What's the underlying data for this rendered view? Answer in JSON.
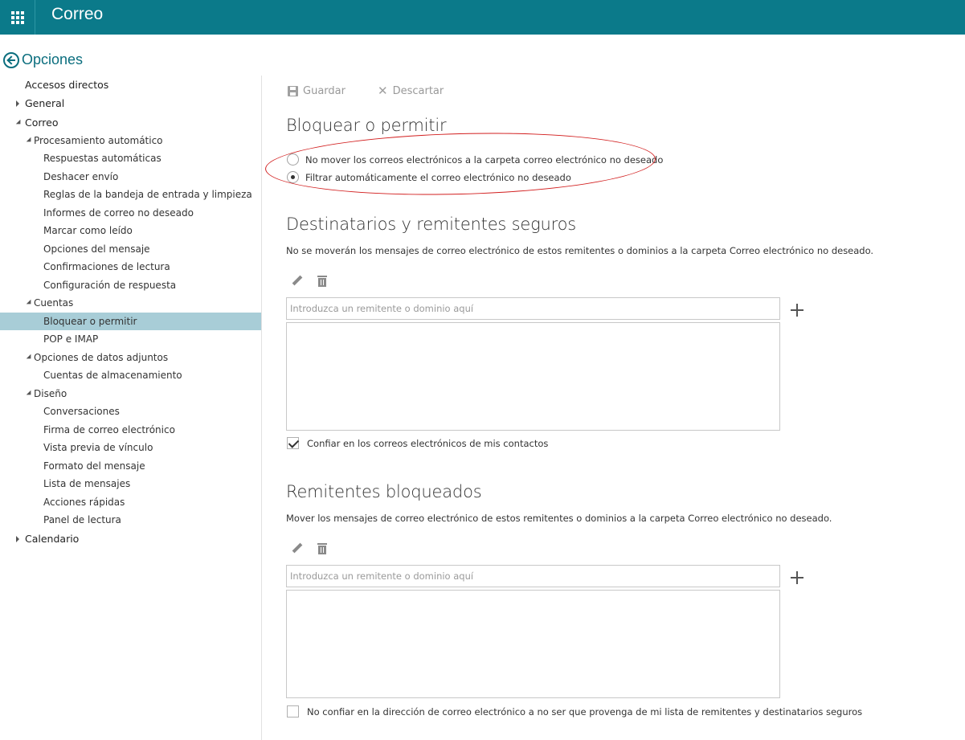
{
  "header": {
    "app_title": "Correo"
  },
  "options": {
    "title": "Opciones"
  },
  "sidebar": {
    "items": [
      {
        "label": "Accesos directos",
        "level": 0,
        "caret": "none",
        "selected": false
      },
      {
        "label": "General",
        "level": 0,
        "caret": "right",
        "selected": false
      },
      {
        "label": "Correo",
        "level": 0,
        "caret": "down",
        "selected": false
      },
      {
        "label": "Procesamiento automático",
        "level": 1,
        "caret": "down",
        "selected": false
      },
      {
        "label": "Respuestas automáticas",
        "level": 2,
        "caret": "none",
        "selected": false
      },
      {
        "label": "Deshacer envío",
        "level": 2,
        "caret": "none",
        "selected": false
      },
      {
        "label": "Reglas de la bandeja de entrada y limpieza",
        "level": 2,
        "caret": "none",
        "selected": false
      },
      {
        "label": "Informes de correo no deseado",
        "level": 2,
        "caret": "none",
        "selected": false
      },
      {
        "label": "Marcar como leído",
        "level": 2,
        "caret": "none",
        "selected": false
      },
      {
        "label": "Opciones del mensaje",
        "level": 2,
        "caret": "none",
        "selected": false
      },
      {
        "label": "Confirmaciones de lectura",
        "level": 2,
        "caret": "none",
        "selected": false
      },
      {
        "label": "Configuración de respuesta",
        "level": 2,
        "caret": "none",
        "selected": false
      },
      {
        "label": "Cuentas",
        "level": 1,
        "caret": "down",
        "selected": false
      },
      {
        "label": "Bloquear o permitir",
        "level": 2,
        "caret": "none",
        "selected": true
      },
      {
        "label": "POP e IMAP",
        "level": 2,
        "caret": "none",
        "selected": false
      },
      {
        "label": "Opciones de datos adjuntos",
        "level": 1,
        "caret": "down",
        "selected": false
      },
      {
        "label": "Cuentas de almacenamiento",
        "level": 2,
        "caret": "none",
        "selected": false
      },
      {
        "label": "Diseño",
        "level": 1,
        "caret": "down",
        "selected": false
      },
      {
        "label": "Conversaciones",
        "level": 2,
        "caret": "none",
        "selected": false
      },
      {
        "label": "Firma de correo electrónico",
        "level": 2,
        "caret": "none",
        "selected": false
      },
      {
        "label": "Vista previa de vínculo",
        "level": 2,
        "caret": "none",
        "selected": false
      },
      {
        "label": "Formato del mensaje",
        "level": 2,
        "caret": "none",
        "selected": false
      },
      {
        "label": "Lista de mensajes",
        "level": 2,
        "caret": "none",
        "selected": false
      },
      {
        "label": "Acciones rápidas",
        "level": 2,
        "caret": "none",
        "selected": false
      },
      {
        "label": "Panel de lectura",
        "level": 2,
        "caret": "none",
        "selected": false
      },
      {
        "label": "Calendario",
        "level": 0,
        "caret": "right",
        "selected": false
      }
    ]
  },
  "toolbar": {
    "save_label": "Guardar",
    "discard_label": "Descartar"
  },
  "block_allow": {
    "heading": "Bloquear o permitir",
    "option_no_move": "No mover los correos electrónicos a la carpeta correo electrónico no deseado",
    "option_filter": "Filtrar automáticamente el correo electrónico no deseado",
    "selected_option": "filter"
  },
  "safe_senders": {
    "heading": "Destinatarios y remitentes seguros",
    "description": "No se moverán los mensajes de correo electrónico de estos remitentes o dominios a la carpeta Correo electrónico no deseado.",
    "input_placeholder": "Introduzca un remitente o dominio aquí",
    "trust_contacts_label": "Confiar en los correos electrónicos de mis contactos",
    "trust_contacts_checked": true
  },
  "blocked_senders": {
    "heading": "Remitentes bloqueados",
    "description": "Mover los mensajes de correo electrónico de estos remitentes o dominios a la carpeta Correo electrónico no deseado.",
    "input_placeholder": "Introduzca un remitente o dominio aquí",
    "dont_trust_label": "No confiar en la dirección de correo electrónico a no ser que provenga de mi lista de remitentes y destinatarios seguros",
    "dont_trust_checked": false
  },
  "colors": {
    "topbar": "#0b7a8a",
    "accent": "#0b6e7e",
    "selected_nav": "#a8cdd7",
    "annotation": "#d21e1e"
  }
}
